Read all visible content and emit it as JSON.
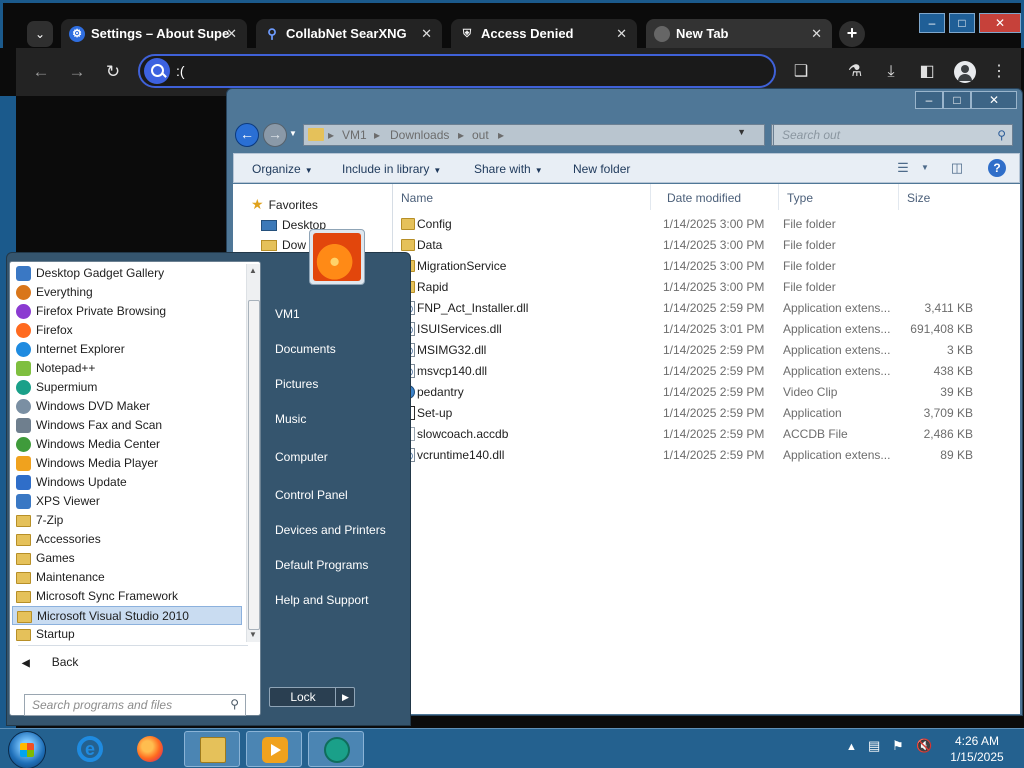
{
  "browser": {
    "tabs": [
      {
        "title": "Settings – About Supe",
        "icon": "gear-icon"
      },
      {
        "title": "CollabNet SearXNG",
        "icon": "search-icon"
      },
      {
        "title": "Access Denied",
        "icon": "shield-icon"
      },
      {
        "title": "New Tab",
        "icon": "globe-icon"
      }
    ],
    "omnibox_value": ":("
  },
  "explorer": {
    "breadcrumbs": [
      "VM1",
      "Downloads",
      "out"
    ],
    "search_placeholder": "Search out",
    "commands": [
      "Organize",
      "Include in library",
      "Share with",
      "New folder"
    ],
    "nav": {
      "favorites": "Favorites",
      "desktop": "Desktop",
      "downloads": "Dow"
    },
    "columns": [
      "Name",
      "Date modified",
      "Type",
      "Size"
    ],
    "files": [
      {
        "name": "Config",
        "date": "1/14/2025 3:00 PM",
        "type": "File folder",
        "size": "",
        "icon": "folder"
      },
      {
        "name": "Data",
        "date": "1/14/2025 3:00 PM",
        "type": "File folder",
        "size": "",
        "icon": "folder"
      },
      {
        "name": "MigrationService",
        "date": "1/14/2025 3:00 PM",
        "type": "File folder",
        "size": "",
        "icon": "folder"
      },
      {
        "name": "Rapid",
        "date": "1/14/2025 3:00 PM",
        "type": "File folder",
        "size": "",
        "icon": "folder"
      },
      {
        "name": "FNP_Act_Installer.dll",
        "date": "1/14/2025 2:59 PM",
        "type": "Application extens...",
        "size": "3,411 KB",
        "icon": "dll"
      },
      {
        "name": "ISUIServices.dll",
        "date": "1/14/2025 3:01 PM",
        "type": "Application extens...",
        "size": "691,408 KB",
        "icon": "dll"
      },
      {
        "name": "MSIMG32.dll",
        "date": "1/14/2025 2:59 PM",
        "type": "Application extens...",
        "size": "3 KB",
        "icon": "dll"
      },
      {
        "name": "msvcp140.dll",
        "date": "1/14/2025 2:59 PM",
        "type": "Application extens...",
        "size": "438 KB",
        "icon": "dll"
      },
      {
        "name": "pedantry",
        "date": "1/14/2025 2:59 PM",
        "type": "Video Clip",
        "size": "39 KB",
        "icon": "video"
      },
      {
        "name": "Set-up",
        "date": "1/14/2025 2:59 PM",
        "type": "Application",
        "size": "3,709 KB",
        "icon": "app"
      },
      {
        "name": "slowcoach.accdb",
        "date": "1/14/2025 2:59 PM",
        "type": "ACCDB File",
        "size": "2,486 KB",
        "icon": "doc"
      },
      {
        "name": "vcruntime140.dll",
        "date": "1/14/2025 2:59 PM",
        "type": "Application extens...",
        "size": "89 KB",
        "icon": "dll"
      }
    ]
  },
  "startmenu": {
    "programs": [
      {
        "label": "Desktop Gadget Gallery",
        "icon": "gadget-icon",
        "color": "#3a78c4",
        "kind": "app"
      },
      {
        "label": "Everything",
        "icon": "magnifier-icon",
        "color": "#d9761a",
        "kind": "round"
      },
      {
        "label": "Firefox Private Browsing",
        "icon": "firefox-private-icon",
        "color": "#8b3bd1",
        "kind": "round"
      },
      {
        "label": "Firefox",
        "icon": "firefox-icon",
        "color": "#ff6a1f",
        "kind": "round"
      },
      {
        "label": "Internet Explorer",
        "icon": "ie-icon",
        "color": "#1f8be0",
        "kind": "round"
      },
      {
        "label": "Notepad++",
        "icon": "notepad-icon",
        "color": "#7fbf3f",
        "kind": "app"
      },
      {
        "label": "Supermium",
        "icon": "supermium-icon",
        "color": "#1aa089",
        "kind": "round"
      },
      {
        "label": "Windows DVD Maker",
        "icon": "dvd-icon",
        "color": "#7a8fa3",
        "kind": "round"
      },
      {
        "label": "Windows Fax and Scan",
        "icon": "fax-icon",
        "color": "#6f7f8e",
        "kind": "app"
      },
      {
        "label": "Windows Media Center",
        "icon": "media-center-icon",
        "color": "#3f9b3b",
        "kind": "round"
      },
      {
        "label": "Windows Media Player",
        "icon": "media-player-icon",
        "color": "#f0a21e",
        "kind": "app"
      },
      {
        "label": "Windows Update",
        "icon": "update-icon",
        "color": "#2f6ec9",
        "kind": "app"
      },
      {
        "label": "XPS Viewer",
        "icon": "xps-icon",
        "color": "#3a78c4",
        "kind": "app"
      },
      {
        "label": "7-Zip",
        "icon": "folder-icon",
        "color": "#e5c15a",
        "kind": "folder"
      },
      {
        "label": "Accessories",
        "icon": "folder-icon",
        "color": "#e5c15a",
        "kind": "folder"
      },
      {
        "label": "Games",
        "icon": "folder-icon",
        "color": "#e5c15a",
        "kind": "folder"
      },
      {
        "label": "Maintenance",
        "icon": "folder-icon",
        "color": "#e5c15a",
        "kind": "folder"
      },
      {
        "label": "Microsoft Sync Framework",
        "icon": "folder-icon",
        "color": "#e5c15a",
        "kind": "folder"
      },
      {
        "label": "Microsoft Visual Studio 2010",
        "icon": "folder-icon",
        "color": "#e5c15a",
        "kind": "folder",
        "selected": true
      },
      {
        "label": "Startup",
        "icon": "folder-icon",
        "color": "#e5c15a",
        "kind": "folder"
      }
    ],
    "back_label": "Back",
    "search_placeholder": "Search programs and files",
    "right_items": [
      "VM1",
      "Documents",
      "Pictures",
      "Music",
      "Computer",
      "Control Panel",
      "Devices and Printers",
      "Default Programs",
      "Help and Support"
    ],
    "lock_label": "Lock"
  },
  "taskbar": {
    "time": "4:26 AM",
    "date": "1/15/2025"
  }
}
